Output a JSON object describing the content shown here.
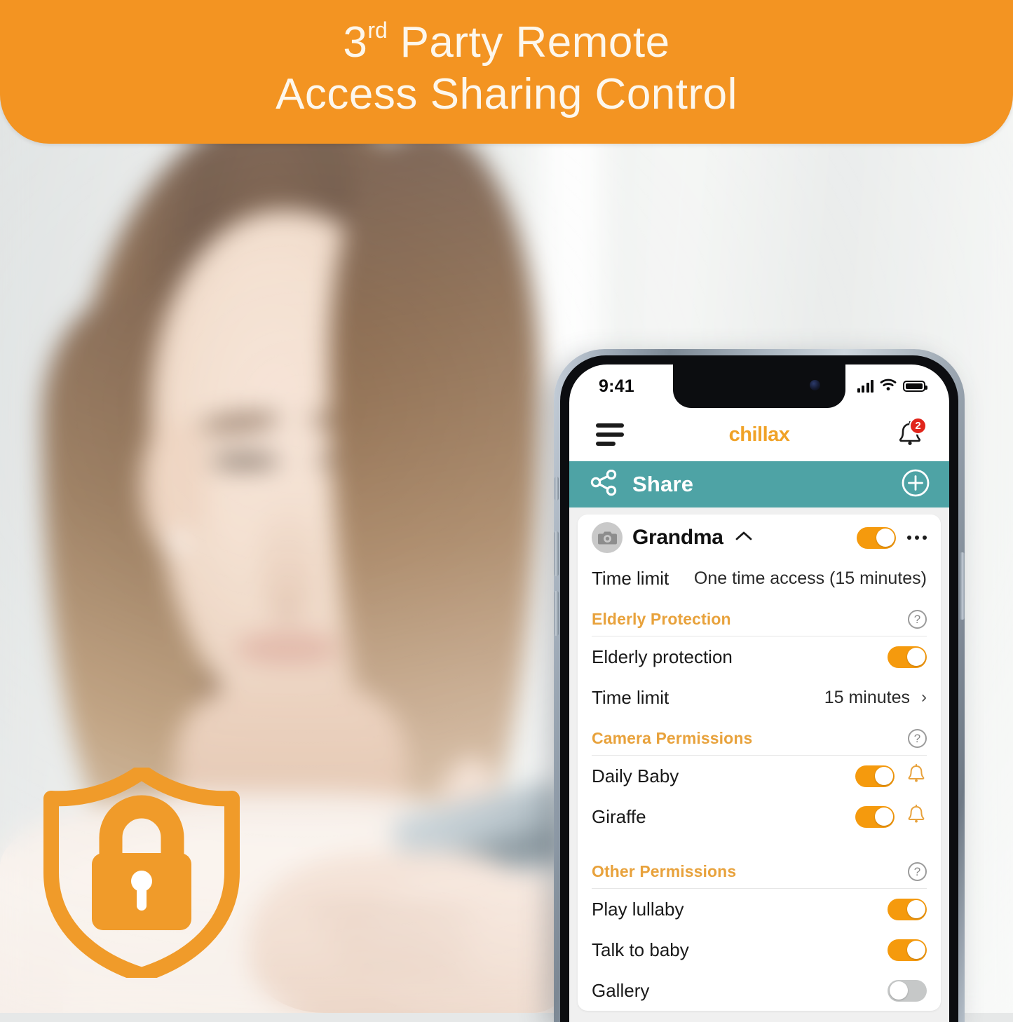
{
  "banner": {
    "line1_number": "3",
    "line1_sup": "rd",
    "line1_rest": " Party Remote",
    "line2": "Access Sharing Control",
    "bg_color": "#f39422",
    "text_color": "#fdf7ec"
  },
  "brand_shield": {
    "icon": "shield-lock-icon",
    "color": "#f09b2a"
  },
  "phone": {
    "status_bar": {
      "time": "9:41",
      "signal_icon": "cellular-signal-icon",
      "wifi_icon": "wifi-icon",
      "battery_icon": "battery-icon"
    },
    "app_header": {
      "menu_icon": "hamburger-menu-icon",
      "brand": "chillax",
      "brand_color": "#f0a227",
      "bell_icon": "notification-bell-icon",
      "bell_badge": "2",
      "badge_color": "#e1251b"
    },
    "share_bar": {
      "icon": "share-nodes-icon",
      "title": "Share",
      "add_icon": "plus-circle-icon",
      "bg_color": "#4ea3a5"
    },
    "user_card": {
      "avatar_icon": "camera-avatar-icon",
      "name": "Grandma",
      "collapse_icon": "chevron-up-icon",
      "enabled": true,
      "more_icon": "more-options-icon",
      "summary": {
        "label": "Time limit",
        "value": "One time access (15 minutes)"
      }
    },
    "sections": [
      {
        "title": "Elderly Protection",
        "help_icon": "help-circle-icon",
        "rows": [
          {
            "label": "Elderly protection",
            "control": "toggle",
            "on": true
          },
          {
            "label": "Time limit",
            "control": "value-chevron",
            "value": "15 minutes",
            "chevron": "›"
          }
        ]
      },
      {
        "title": "Camera Permissions",
        "help_icon": "help-circle-icon",
        "rows": [
          {
            "label": "Daily Baby",
            "control": "toggle-bell",
            "on": true,
            "bell_icon": "bell-outline-icon"
          },
          {
            "label": "Giraffe",
            "control": "toggle-bell",
            "on": true,
            "bell_icon": "bell-outline-icon"
          }
        ]
      },
      {
        "title": "Other Permissions",
        "help_icon": "help-circle-icon",
        "rows": [
          {
            "label": "Play lullaby",
            "control": "toggle",
            "on": true
          },
          {
            "label": "Talk to baby",
            "control": "toggle",
            "on": true
          },
          {
            "label": "Gallery",
            "control": "toggle",
            "on": false
          }
        ]
      }
    ],
    "colors": {
      "toggle_on": "#f59a0d",
      "toggle_off": "#c6c8c8",
      "section_title": "#e8a23c"
    }
  }
}
